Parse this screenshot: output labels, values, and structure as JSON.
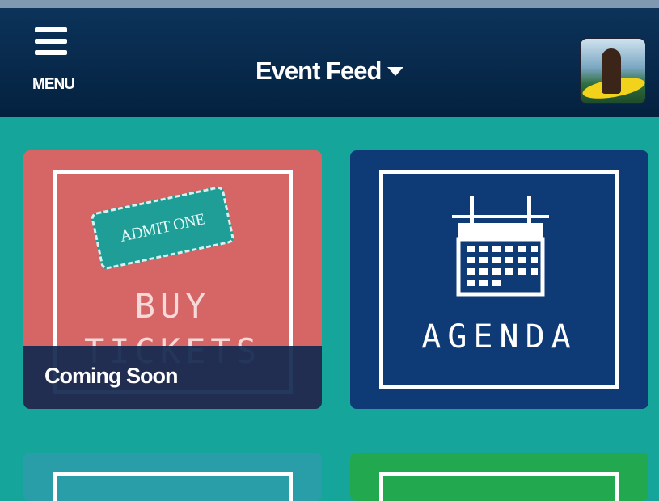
{
  "header": {
    "menu_label": "MENU",
    "title": "Event Feed"
  },
  "tiles": [
    {
      "ticket_text": "ADMIT ONE",
      "label": "BUY",
      "label_hidden": "TICKETS",
      "overlay": "Coming Soon",
      "color": "#d66565"
    },
    {
      "label": "AGENDA",
      "color": "#0e3a75"
    }
  ],
  "colors": {
    "background": "#15a59a",
    "header": "#04213f"
  }
}
